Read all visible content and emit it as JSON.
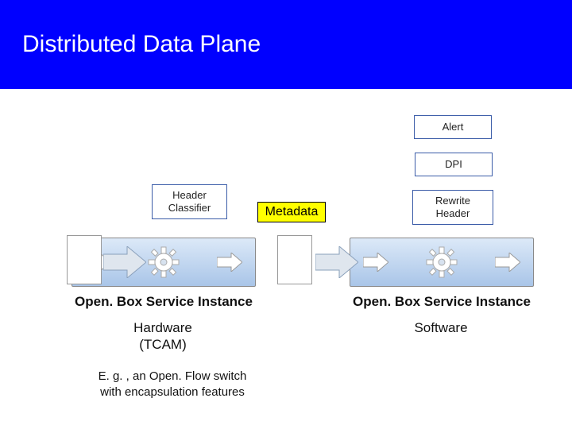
{
  "title": "Distributed Data Plane",
  "boxes": {
    "alert": "Alert",
    "dpi": "DPI",
    "rewrite_l1": "Rewrite",
    "rewrite_l2": "Header",
    "hc_l1": "Header",
    "hc_l2": "Classifier",
    "metadata": "Metadata"
  },
  "labels": {
    "svc_left": "Open. Box Service Instance",
    "svc_right": "Open. Box Service Instance",
    "hardware_l1": "Hardware",
    "hardware_l2": "(TCAM)",
    "software": "Software",
    "example_l1": "E. g. , an Open. Flow switch",
    "example_l2": "with encapsulation features"
  },
  "colors": {
    "title_bg": "#0000ff",
    "box_border": "#3b5ca8",
    "metadata_bg": "#ffff00",
    "service_grad_from": "#dce9f8",
    "service_grad_to": "#a9c5e8",
    "arrow_fill": "#dfe6ee"
  }
}
